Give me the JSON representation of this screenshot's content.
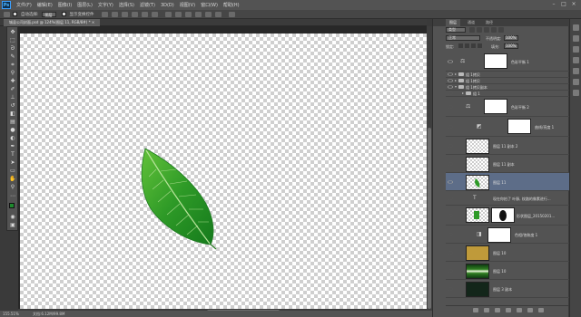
{
  "app": {
    "logo": "Ps"
  },
  "menu": [
    "文件(F)",
    "编辑(E)",
    "图像(I)",
    "图层(L)",
    "文字(Y)",
    "选择(S)",
    "滤镜(T)",
    "3D(D)",
    "视图(V)",
    "窗口(W)",
    "帮助(H)"
  ],
  "window_controls": {
    "minimize": "–",
    "maximize": "□",
    "close": "×"
  },
  "options": {
    "auto_select_label": "自动选择:",
    "auto_select_value": "图层",
    "show_transform_label": "显示变换控件"
  },
  "document": {
    "tab_title": "城县公司封面.psd @ 124%(图层 11, RGB/8#) * ×"
  },
  "status": {
    "zoom": "155.51%",
    "doc": "文档:6.12M/99.8M"
  },
  "panels": {
    "tabs": [
      "图层",
      "通道",
      "路径"
    ],
    "kind": "类型",
    "blend_mode": "正常",
    "opacity_label": "不透明度:",
    "opacity": "100%",
    "lock_label": "锁定:",
    "fill_label": "填充:",
    "fill": "100%"
  },
  "layers": [
    {
      "name": "色彩平衡 1",
      "type": "adjustment",
      "thumb": "white",
      "visible": true,
      "selected": false
    },
    {
      "name": "组 1拷贝",
      "type": "group",
      "visible": true
    },
    {
      "name": "组 1拷贝",
      "type": "group",
      "visible": true
    },
    {
      "name": "组 1拷贝副本",
      "type": "group",
      "visible": true
    },
    {
      "name": "组 1",
      "type": "group",
      "visible": false
    },
    {
      "name": "色彩平衡 2",
      "type": "adjustment",
      "thumb": "white",
      "visible": false
    },
    {
      "name": "曲线/亮度 1",
      "type": "adjustment",
      "thumb": "white",
      "visible": false
    },
    {
      "name": "图层 11 副本 2",
      "type": "pixel",
      "thumb": "check",
      "visible": false
    },
    {
      "name": "图层 11 副本",
      "type": "pixel",
      "thumb": "check",
      "visible": false
    },
    {
      "name": "图层 11",
      "type": "pixel",
      "thumb": "check",
      "visible": true,
      "selected": true
    },
    {
      "name": "现在你拍了  叶脉, 纹路的像素进行...",
      "type": "text",
      "visible": false
    },
    {
      "name": "形状图层_20150201...",
      "type": "smart",
      "thumb": "check",
      "visible": false
    },
    {
      "name": "色相/饱和度 1",
      "type": "adjustment",
      "thumb": "white",
      "visible": false
    },
    {
      "name": "图层 10",
      "type": "pixel",
      "thumb": "gold",
      "visible": false
    },
    {
      "name": "图层 10",
      "type": "pixel",
      "thumb": "greenband",
      "visible": false
    },
    {
      "name": "图层 3 副本",
      "type": "pixel",
      "thumb": "darkgreen",
      "visible": false
    }
  ]
}
